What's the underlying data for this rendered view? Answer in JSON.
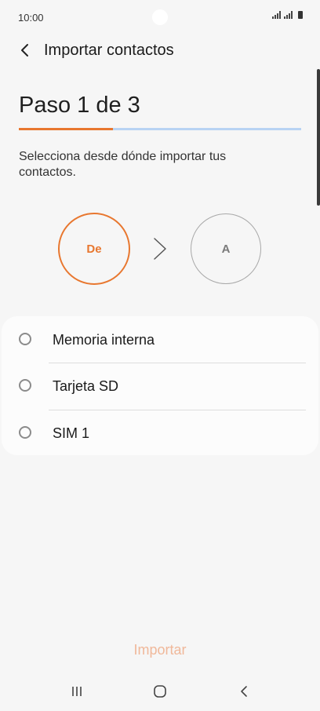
{
  "status_bar": {
    "time": "10:00"
  },
  "app_bar": {
    "title": "Importar contactos"
  },
  "step": {
    "title": "Paso 1 de 3",
    "progress": 0.333
  },
  "instruction": "Selecciona desde dónde importar tus contactos.",
  "flow": {
    "from_label": "De",
    "to_label": "A"
  },
  "options": [
    {
      "label": "Memoria interna",
      "selected": false
    },
    {
      "label": "Tarjeta SD",
      "selected": false
    },
    {
      "label": "SIM 1",
      "selected": false
    }
  ],
  "import_button": {
    "label": "Importar"
  },
  "colors": {
    "accent": "#e8772f",
    "progress_track": "#b8d3f3",
    "disabled_text": "#f0b89a"
  },
  "icons": {
    "back": "chevron-left-icon",
    "arrow": "chevron-right-icon",
    "nav_recent": "recents-icon",
    "nav_home": "home-icon",
    "nav_back": "back-icon"
  }
}
